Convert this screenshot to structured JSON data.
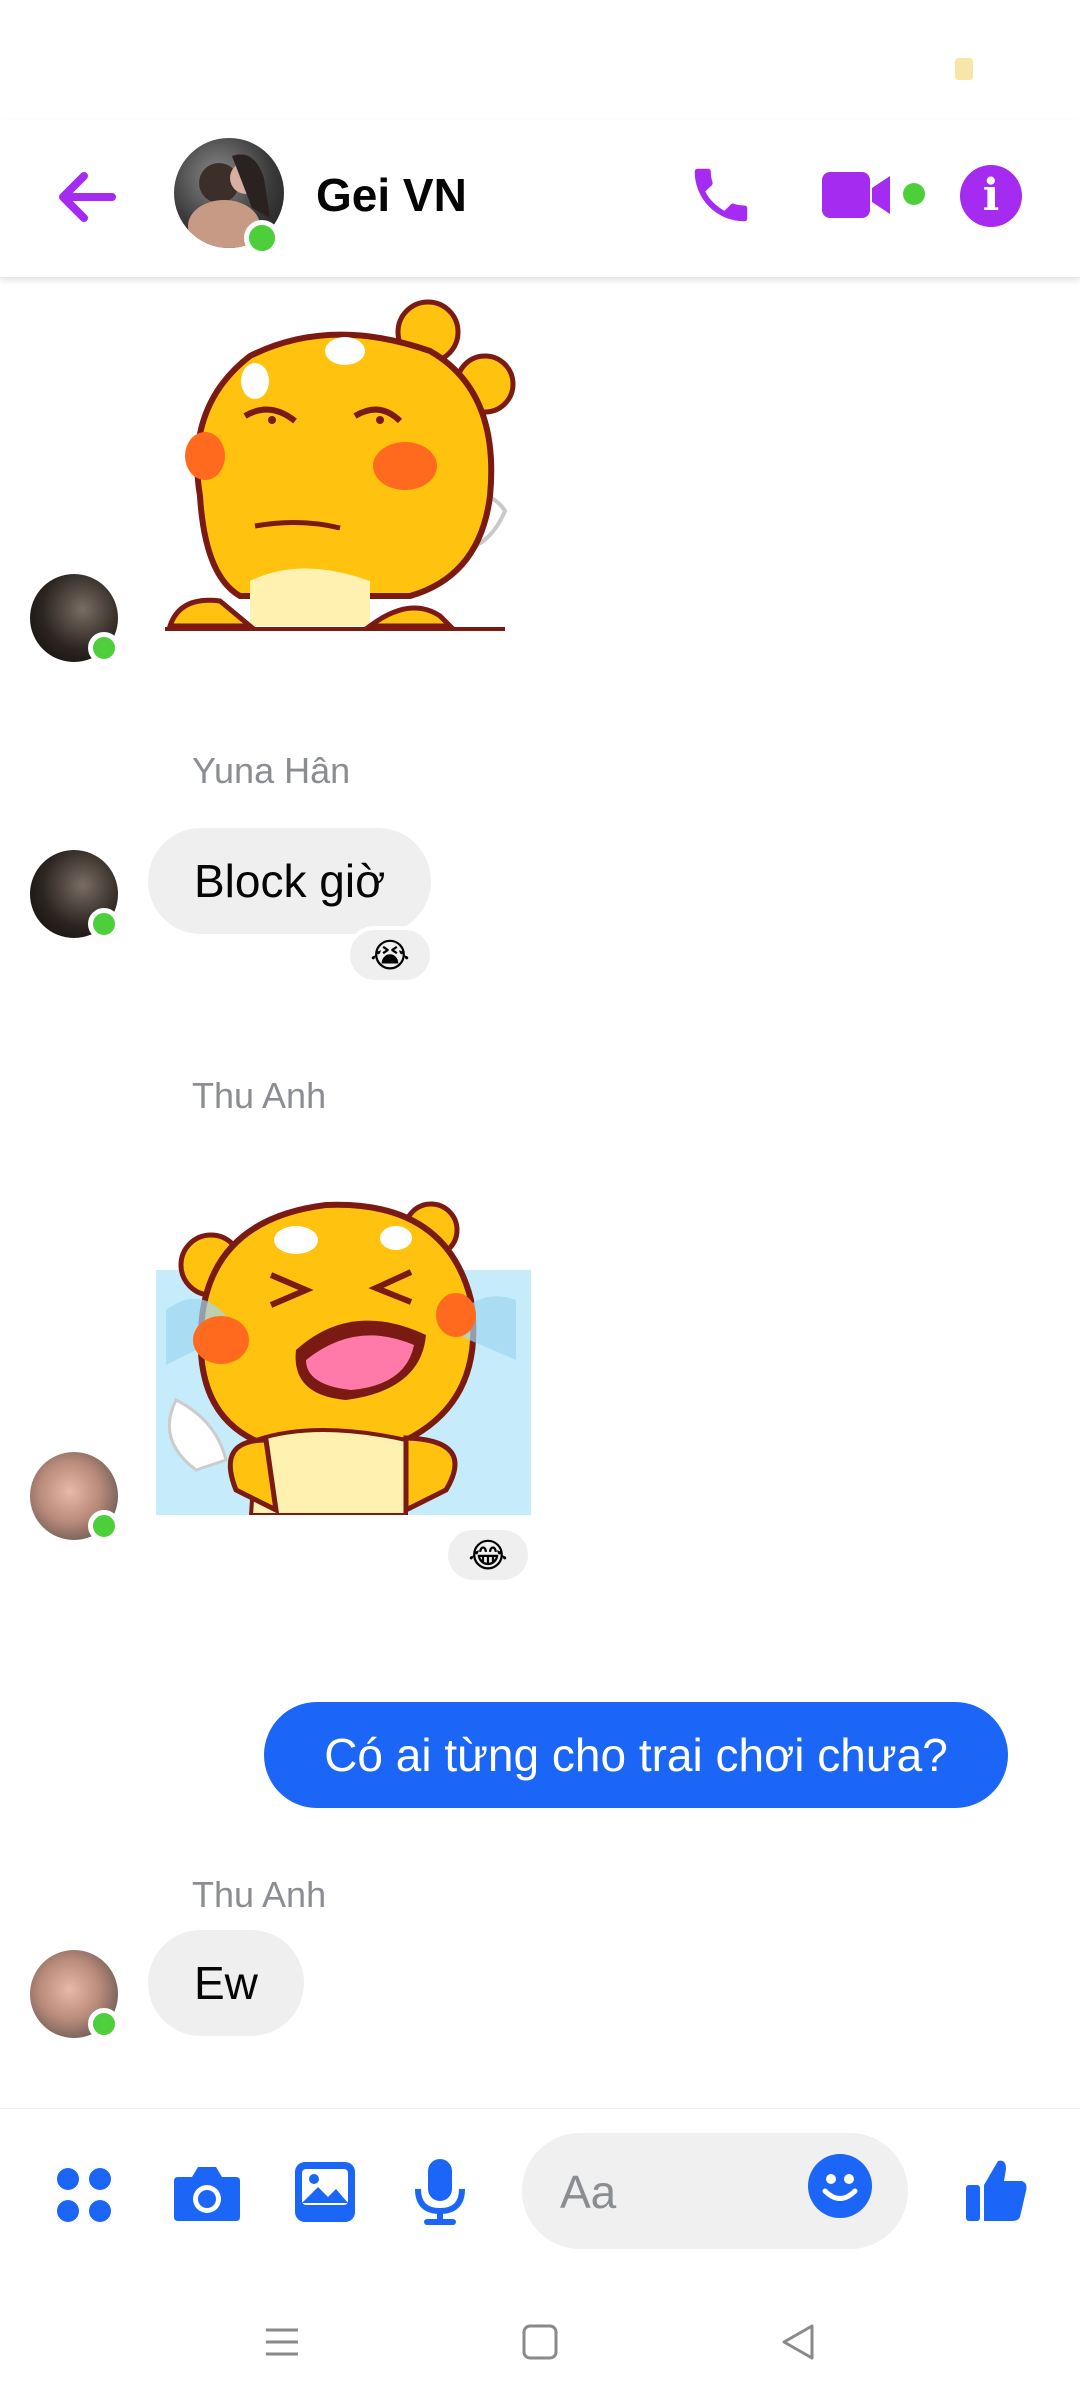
{
  "header": {
    "title": "Gei VN",
    "back_icon": "arrow-left-icon",
    "call_icon": "phone-icon",
    "video_icon": "video-camera-icon",
    "info_icon": "info-icon",
    "info_glyph": "i"
  },
  "messages": [
    {
      "type": "sticker",
      "sticker": "yellow-bear-smirk-sticker"
    },
    {
      "type": "text",
      "sender": "Yuna Hân",
      "text": "Block giờ",
      "reaction": "😭"
    },
    {
      "type": "sticker",
      "sender": "Thu Anh",
      "sticker": "yellow-bear-crying-sticker",
      "reaction": "😂"
    },
    {
      "type": "text",
      "outgoing": true,
      "text": "Có ai từng cho trai chơi chưa?"
    },
    {
      "type": "text",
      "sender": "Thu Anh",
      "text": "Ew"
    }
  ],
  "composer": {
    "placeholder": "Aa",
    "icons": [
      "apps-icon",
      "camera-icon",
      "image-icon",
      "microphone-icon",
      "emoji-icon",
      "thumbs-up-icon"
    ]
  },
  "colors": {
    "header_accent": "#a52bf0",
    "composer_accent": "#1b66f6",
    "outgoing_bubble": "#1b66f6",
    "incoming_bubble": "#efefef",
    "online": "#4ccf3a"
  }
}
